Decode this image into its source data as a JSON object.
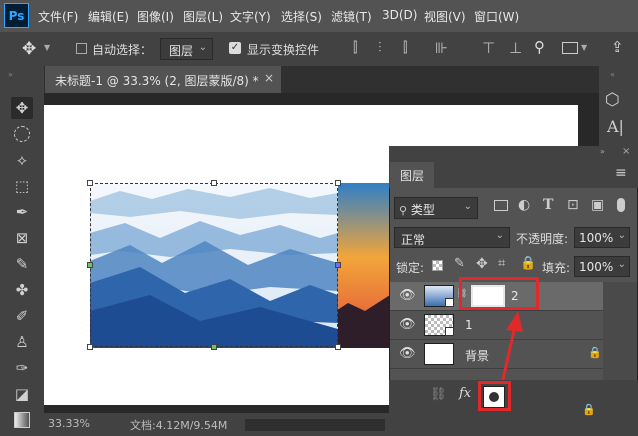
{
  "app": {
    "logo": "Ps"
  },
  "menu": [
    "文件(F)",
    "编辑(E)",
    "图像(I)",
    "图层(L)",
    "文字(Y)",
    "选择(S)",
    "滤镜(T)",
    "3D(D)",
    "视图(V)",
    "窗口(W)"
  ],
  "options_bar": {
    "auto_select_label": "自动选择：",
    "auto_select_value": "图层",
    "show_transform_label": "显示变换控件"
  },
  "document": {
    "tab_title": "未标题-1 @ 33.3% (2, 图层蒙版/8) *",
    "close_glyph": "×"
  },
  "status": {
    "zoom": "33.33%",
    "doc_info": "文档:4.12M/9.54M"
  },
  "layers_panel": {
    "tab_title": "图层",
    "filter_kind": "类型",
    "blend_mode": "正常",
    "opacity_label": "不透明度:",
    "opacity_value": "100%",
    "lock_label": "锁定:",
    "fill_label": "填充:",
    "fill_value": "100%",
    "layers": [
      {
        "name": "2",
        "has_mask": true,
        "selected": true
      },
      {
        "name": "1",
        "has_mask": false,
        "selected": false
      },
      {
        "name": "背景",
        "has_mask": false,
        "selected": false,
        "locked": true
      }
    ],
    "footer": {
      "fx": "fx"
    }
  },
  "colors": {
    "highlight": "#e0292b",
    "ps_blue": "#31a8ff"
  }
}
